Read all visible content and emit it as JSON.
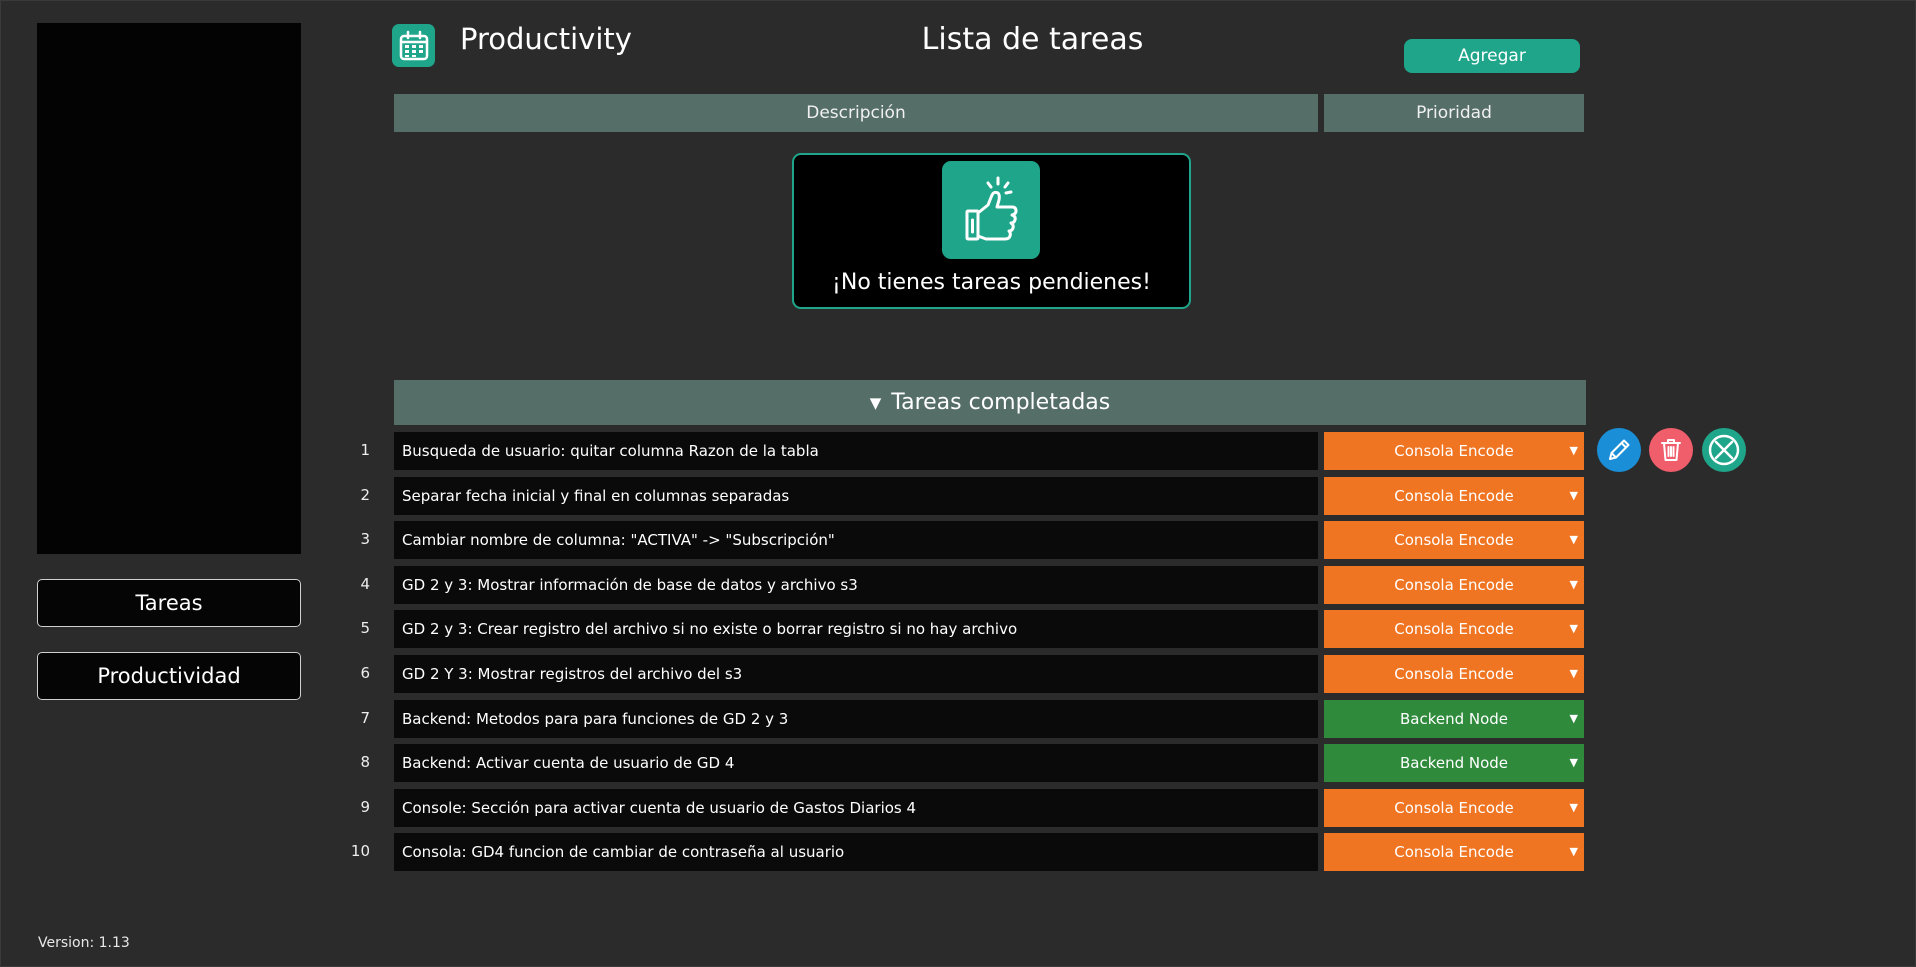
{
  "sidebar": {
    "nav": [
      {
        "label": "Tareas"
      },
      {
        "label": "Productividad"
      }
    ],
    "version": "Version: 1.13"
  },
  "header": {
    "app_name": "Productivity",
    "title": "Lista de tareas",
    "add_label": "Agregar"
  },
  "table": {
    "col_description": "Descripción",
    "col_priority": "Prioridad"
  },
  "empty_state": {
    "message": "¡No tienes tareas pendienes!",
    "icon": "thumbs-up-icon"
  },
  "completed": {
    "title": "Tareas completadas",
    "rows": [
      {
        "num": "1",
        "description": "Busqueda de usuario: quitar columna Razon de la tabla",
        "priority": "Consola Encode"
      },
      {
        "num": "2",
        "description": "Separar fecha inicial y final en columnas separadas",
        "priority": "Consola Encode"
      },
      {
        "num": "3",
        "description": "Cambiar nombre de columna: \"ACTIVA\" -> \"Subscripción\"",
        "priority": "Consola Encode"
      },
      {
        "num": "4",
        "description": "GD 2 y 3: Mostrar información de base de datos y archivo s3",
        "priority": "Consola Encode"
      },
      {
        "num": "5",
        "description": "GD 2 y 3: Crear registro del archivo si no existe o borrar registro si no hay archivo",
        "priority": "Consola Encode"
      },
      {
        "num": "6",
        "description": "GD 2 Y 3: Mostrar registros del archivo del s3",
        "priority": "Consola Encode"
      },
      {
        "num": "7",
        "description": "Backend: Metodos para para funciones de GD 2 y 3",
        "priority": "Backend Node"
      },
      {
        "num": "8",
        "description": "Backend: Activar cuenta de usuario de GD 4",
        "priority": "Backend Node"
      },
      {
        "num": "9",
        "description": "Console: Sección para activar cuenta de usuario de Gastos Diarios 4",
        "priority": "Consola Encode"
      },
      {
        "num": "10",
        "description": "Consola: GD4 funcion de cambiar de contraseña al usuario",
        "priority": "Consola Encode"
      }
    ]
  },
  "colors": {
    "accent": "#1fa58a",
    "header_bg": "#566e68",
    "consola_encode": "#f07522",
    "backend_node": "#2f8a3c",
    "edit": "#1a8fd8",
    "delete": "#f05d6b"
  },
  "row_actions": [
    {
      "icon": "pencil-icon"
    },
    {
      "icon": "trash-icon"
    },
    {
      "icon": "close-circle-icon"
    }
  ]
}
